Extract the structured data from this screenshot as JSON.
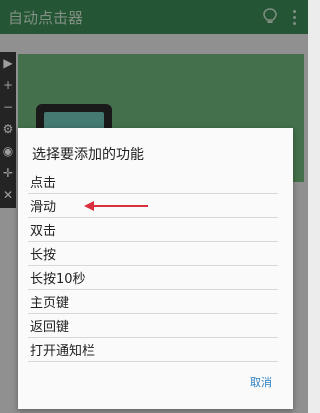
{
  "appbar": {
    "title": "自动点击器"
  },
  "background": {
    "banner_text": "",
    "bottom_text": ""
  },
  "dialog": {
    "title": "选择要添加的功能",
    "options": [
      "点击",
      "滑动",
      "双击",
      "长按",
      "长按10秒",
      "主页键",
      "返回键",
      "打开通知栏"
    ],
    "cancel_label": "取消"
  },
  "floatbar": {
    "icons": [
      "play-icon",
      "plus-icon",
      "minus-icon",
      "gear-icon",
      "eye-off-icon",
      "move-icon",
      "close-icon"
    ]
  },
  "colors": {
    "appbar": "#3a8a54",
    "accent_cancel": "#2e7fc0",
    "annotation_arrow": "#d9303e"
  }
}
